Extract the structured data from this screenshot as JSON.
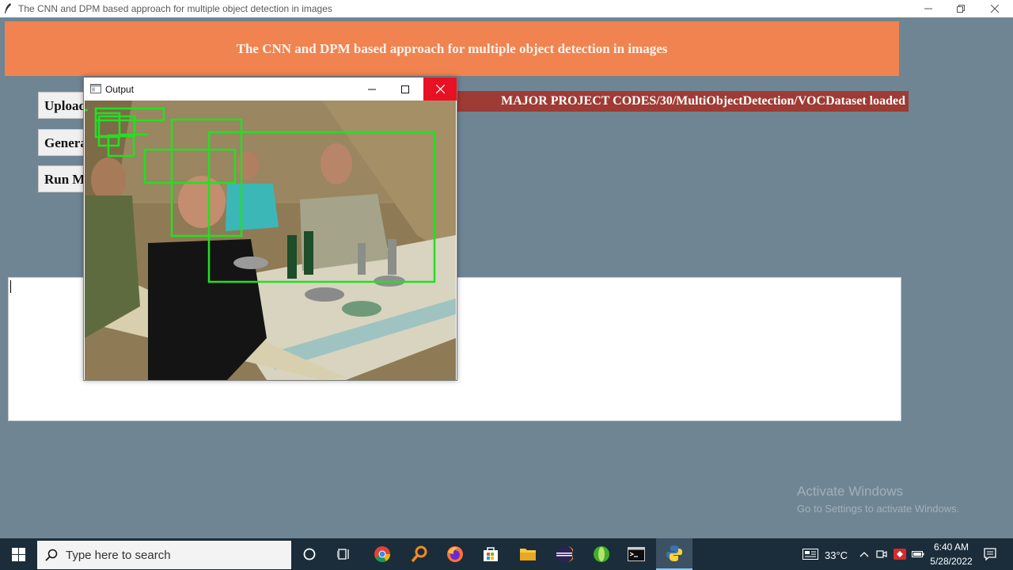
{
  "window": {
    "title": "The CNN and DPM based approach for multiple object detection in images"
  },
  "banner": {
    "title": "The CNN and DPM based approach for multiple object detection in images",
    "bg": "#f0834f"
  },
  "buttons": {
    "upload": "Upload",
    "generate": "Generat",
    "run": "Run M"
  },
  "status": {
    "text": "MAJOR PROJECT CODES/30/MultiObjectDetection/VOCDataset loaded",
    "bg": "#9d3b34"
  },
  "output_window": {
    "title": "Output"
  },
  "watermark": {
    "line1": "Activate Windows",
    "line2": "Go to Settings to activate Windows."
  },
  "taskbar": {
    "search_placeholder": "Type here to search",
    "weather": "33°C",
    "time": "6:40 AM",
    "date": "5/28/2022",
    "apps": [
      "start-icon",
      "search-icon",
      "cortana-icon",
      "task-view-icon",
      "chrome-icon",
      "search-app-icon",
      "firefox-icon",
      "store-icon",
      "file-explorer-icon",
      "eclipse-icon",
      "green-app-icon",
      "terminal-icon",
      "python-icon"
    ]
  }
}
